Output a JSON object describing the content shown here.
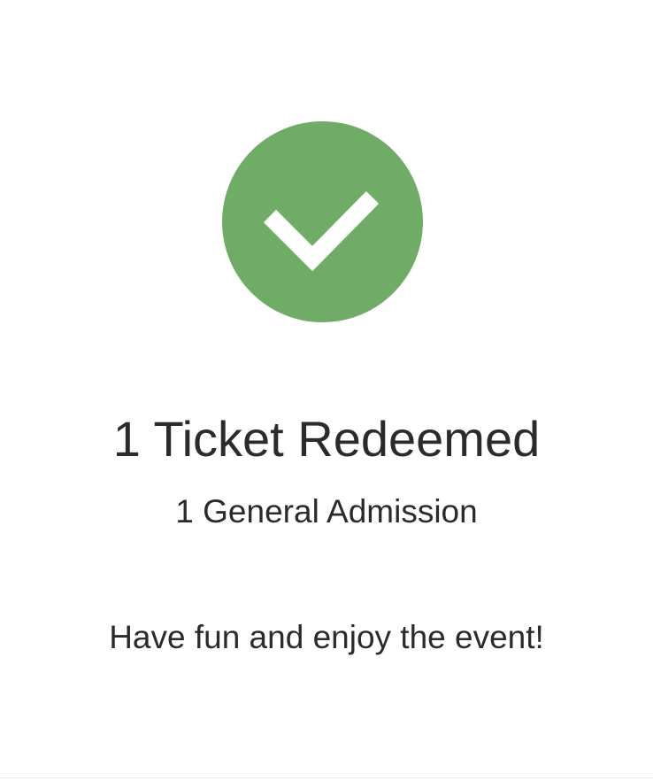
{
  "status": {
    "icon": "check-circle-icon",
    "color": "#6fac66",
    "title": "1 Ticket Redeemed",
    "detail": "1 General Admission",
    "message": "Have fun and enjoy the event!"
  }
}
